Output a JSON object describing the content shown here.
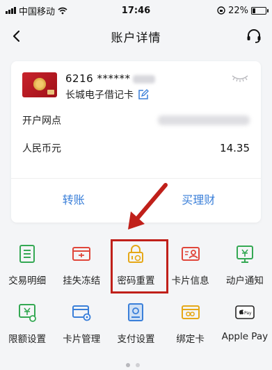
{
  "status_bar": {
    "carrier": "中国移动",
    "time": "17:46",
    "battery_percent": "22%",
    "battery_level": 0.22
  },
  "nav": {
    "title": "账户详情"
  },
  "card": {
    "number": "6216 ******",
    "name": "长城电子借记卡",
    "branch_label": "开户网点",
    "currency_label": "人民币元",
    "balance": "14.35",
    "actions": [
      {
        "label": "转账"
      },
      {
        "label": "买理财"
      }
    ]
  },
  "menu": {
    "row1": [
      {
        "label": "交易明细",
        "icon": "list-icon",
        "color": "#34a853"
      },
      {
        "label": "挂失冻结",
        "icon": "lock-card-icon",
        "color": "#e0463a"
      },
      {
        "label": "密码重置",
        "icon": "password-reset-icon",
        "color": "#e6a817"
      },
      {
        "label": "卡片信息",
        "icon": "card-info-icon",
        "color": "#e0463a"
      },
      {
        "label": "动户通知",
        "icon": "notice-icon",
        "color": "#34a853"
      }
    ],
    "row2": [
      {
        "label": "限额设置",
        "icon": "limit-icon",
        "color": "#34a853"
      },
      {
        "label": "卡片管理",
        "icon": "card-manage-icon",
        "color": "#3a7fd9"
      },
      {
        "label": "支付设置",
        "icon": "payment-icon",
        "color": "#3a7fd9"
      },
      {
        "label": "绑定卡",
        "icon": "bind-card-icon",
        "color": "#e6a817"
      },
      {
        "label": "Apple Pay",
        "icon": "apple-pay-icon",
        "color": "#222222"
      }
    ]
  },
  "colors": {
    "accent_blue": "#3a7fd9",
    "highlight_red": "#c0201a"
  }
}
